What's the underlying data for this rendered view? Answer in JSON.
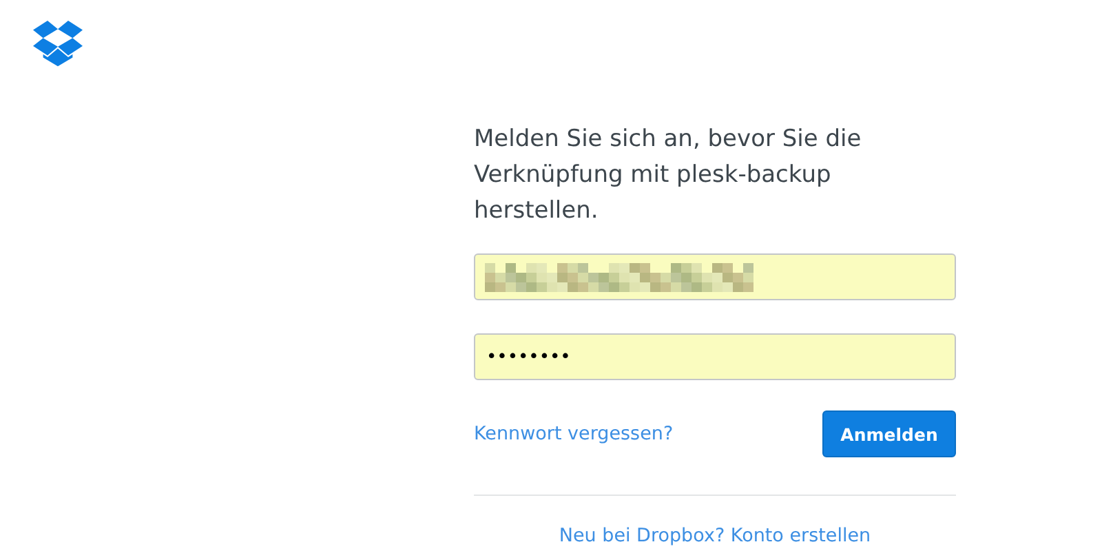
{
  "heading": "Melden Sie sich an, bevor Sie die Verknüpfung mit plesk-backup herstellen.",
  "fields": [
    {
      "kind": "pixelated"
    },
    {
      "kind": "password",
      "value": "••••••••"
    }
  ],
  "forgot_link": "Kennwort vergessen?",
  "submit_button": "Anmelden",
  "signup_link": "Neu bei Dropbox? Konto erstellen"
}
